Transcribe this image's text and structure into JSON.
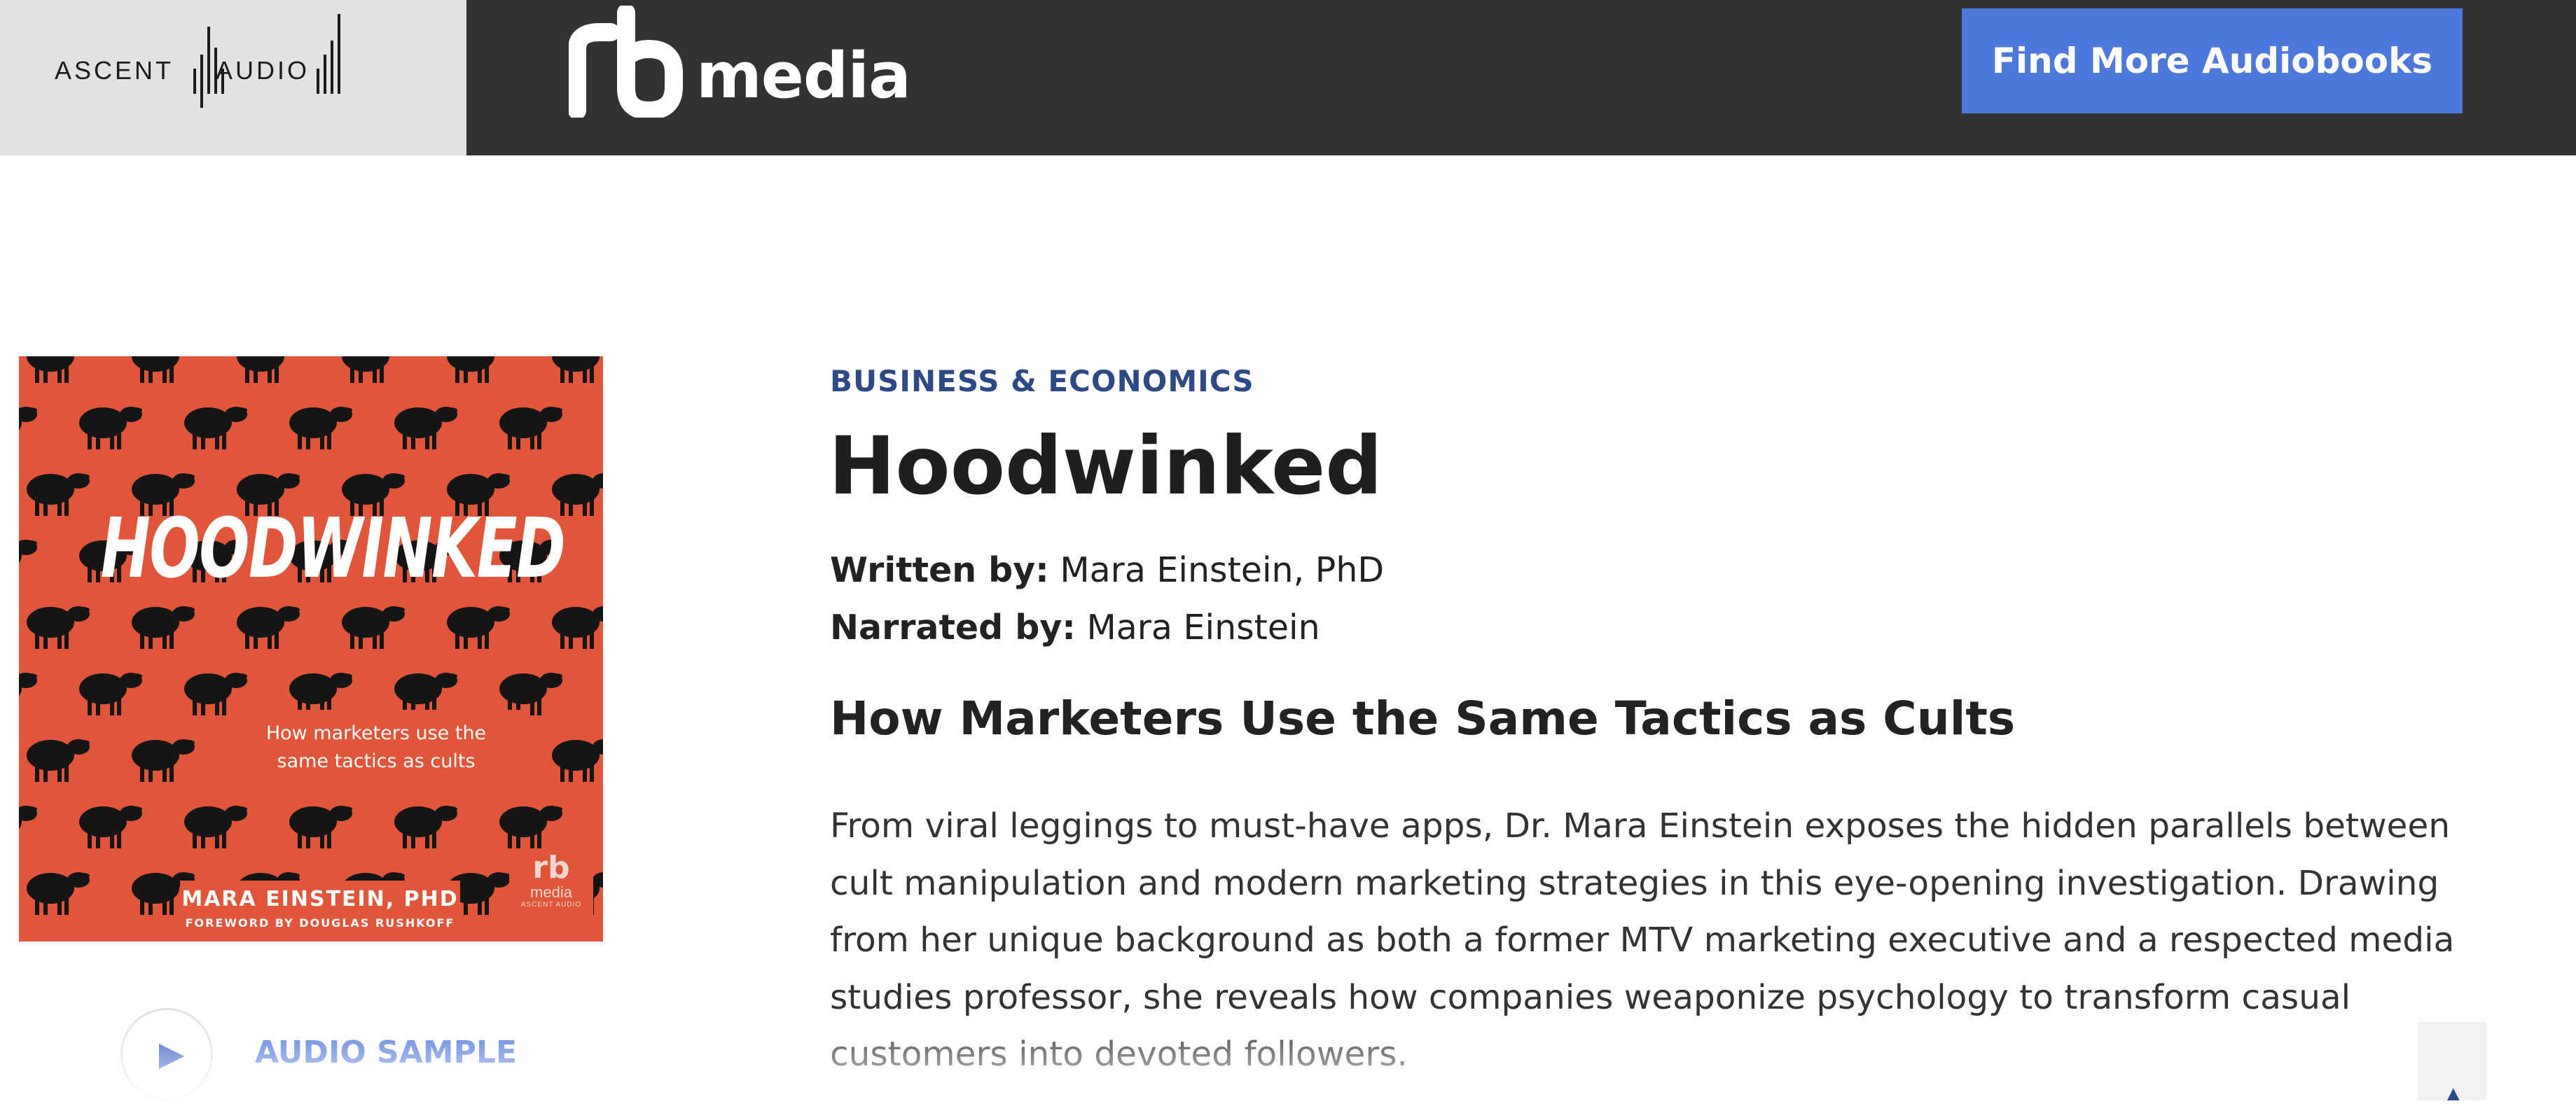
{
  "header": {
    "publisher_logo_text": "ASCENT AUDIO",
    "publisher_logo_left": "ASCENT",
    "publisher_logo_right": "AUDIO",
    "brand_logo_mark": "rb",
    "brand_logo_text": "media",
    "cta_label": "Find More Audiobooks"
  },
  "book": {
    "cover": {
      "title": "HOODWINKED",
      "subtitle_line1": "How marketers use the",
      "subtitle_line2": "same tactics as cults",
      "author": "MARA EINSTEIN, PHD",
      "foreword": "FOREWORD BY DOUGLAS RUSHKOFF",
      "rb_mark": "rb",
      "rb_media": "media",
      "rb_imprint": "ASCENT AUDIO"
    },
    "category": "BUSINESS & ECONOMICS",
    "title": "Hoodwinked",
    "written_label": "Written by:",
    "written_by": "Mara Einstein, PhD",
    "narrated_label": "Narrated by:",
    "narrated_by": "Mara Einstein",
    "subtitle": "How Marketers Use the Same Tactics as Cults",
    "description": "From viral leggings to must-have apps, Dr. Mara Einstein exposes the hidden parallels between cult manipulation and modern marketing strategies in this eye-opening investigation. Drawing from her unique background as both a former MTV marketing executive and a respected media studies professor, she reveals how companies weaponize psychology to transform casual customers into devoted followers."
  },
  "audio_sample": {
    "label": "AUDIO SAMPLE",
    "icon": "play-icon"
  },
  "icons": {
    "scroll_top": "chevron-up-icon"
  },
  "colors": {
    "header_bg": "#313234",
    "publisher_bg": "#e2e2e2",
    "accent_blue": "#4f78dc",
    "category_blue": "#2d4a86",
    "cover_orange": "#e1563a"
  }
}
